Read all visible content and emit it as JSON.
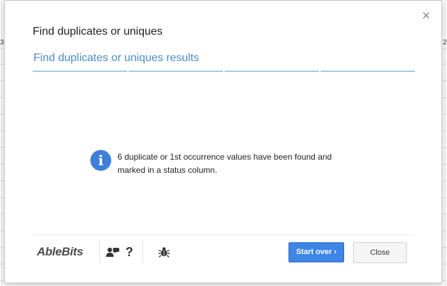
{
  "dialog": {
    "title": "Find duplicates or uniques",
    "close_glyph": "×",
    "tab_title": "Find duplicates or uniques results",
    "message": "6 duplicate or 1st occurrence values have been found and marked in a status column.",
    "info_icon": "info-icon",
    "accent_color": "#4a8cc7",
    "info_color": "#3d7fd9"
  },
  "footer": {
    "logo": "AbleBits",
    "help_label": "?",
    "start_over_label": "Start over",
    "start_over_chevron": "›",
    "close_label": "Close",
    "primary_color": "#3d86e6"
  },
  "sheet": {
    "left_fragment": "3",
    "right_fragment": "2"
  }
}
